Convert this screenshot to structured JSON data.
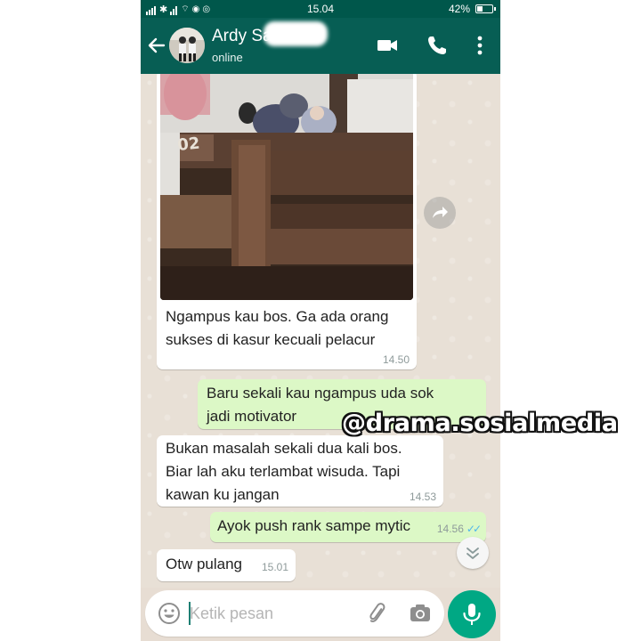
{
  "status_bar": {
    "time": "15.04",
    "battery": "42%",
    "battery_level": 0.42
  },
  "header": {
    "contact_name": "Ardy Sa",
    "contact_status": "online"
  },
  "messages": [
    {
      "direction": "in",
      "type": "image",
      "text": "Ngampus kau bos. Ga ada orang\nsukses di kasur kecuali pelacur",
      "time": "14.50"
    },
    {
      "direction": "out",
      "type": "text",
      "text": "Baru sekali kau ngampus uda sok\njadi motivator",
      "time": ""
    },
    {
      "direction": "in",
      "type": "text",
      "text": "Bukan masalah sekali dua kali bos.\nBiar lah aku terlambat wisuda. Tapi\nkawan ku jangan",
      "time": "14.53"
    },
    {
      "direction": "out",
      "type": "text",
      "text": "Ayok push rank sampe mytic",
      "time": "14.56",
      "read": true
    },
    {
      "direction": "in",
      "type": "text",
      "text": "Otw pulang",
      "time": "15.01"
    }
  ],
  "input": {
    "placeholder": "Ketik pesan"
  },
  "watermark": "@drama.sosialmedia",
  "icons": [
    "back-arrow-icon",
    "video-call-icon",
    "phone-icon",
    "more-vert-icon",
    "forward-icon",
    "chevron-down-icon",
    "emoji-icon",
    "attach-icon",
    "camera-icon",
    "mic-icon"
  ],
  "colors": {
    "header": "#075e54",
    "status_bar": "#00574b",
    "outgoing_bubble": "#dcf8c6",
    "incoming_bubble": "#ffffff",
    "accent": "#00a884",
    "read_ticks": "#4fb6ec"
  }
}
